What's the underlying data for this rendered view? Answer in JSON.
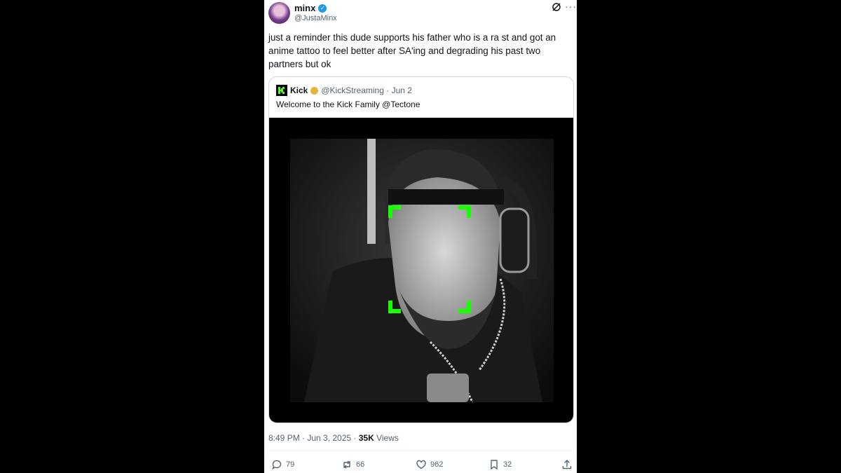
{
  "tweet": {
    "display_name": "minx",
    "handle": "@JustaMinx",
    "text": "just a reminder this dude supports his father who is a ra   st and got an anime tattoo to feel better after SA'ing and degrading his past two partners but ok",
    "timestamp": "8:49 PM · Jun 3, 2025 · ",
    "views_count": "35K",
    "views_label": " Views"
  },
  "quoted": {
    "display_name": "Kick",
    "handle_date": "@KickStreaming · Jun 2",
    "text": "Welcome to the Kick Family @Tectone",
    "logo_letter": "K"
  },
  "actions": {
    "replies": "79",
    "reposts": "66",
    "likes": "962",
    "bookmarks": "32"
  },
  "icons": [
    "verified-icon",
    "grok-icon",
    "more-icon",
    "reply-icon",
    "repost-icon",
    "like-icon",
    "bookmark-icon",
    "share-icon"
  ],
  "colors": {
    "accent": "#1d9bf0",
    "kick_green": "#53fc18",
    "text_secondary": "#536471"
  }
}
